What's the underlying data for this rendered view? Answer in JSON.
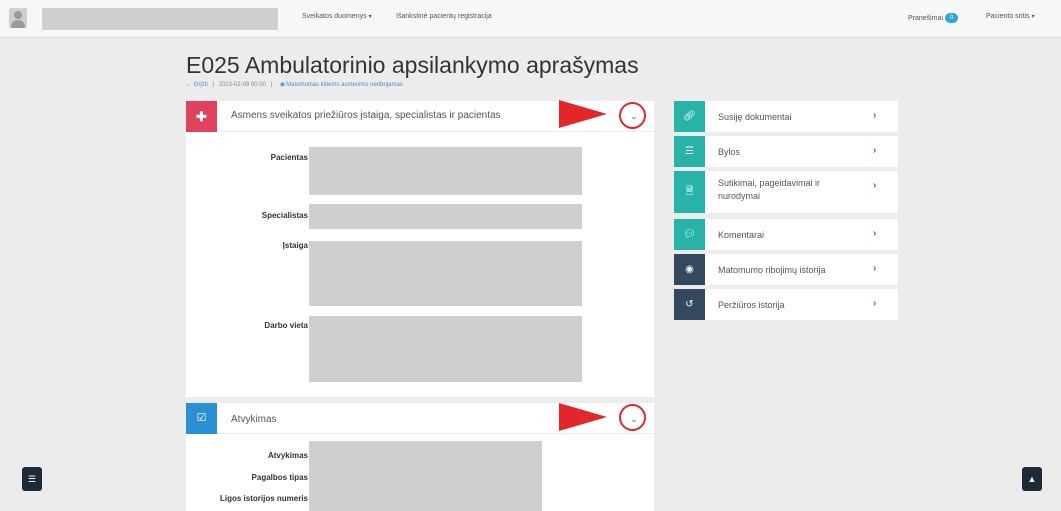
{
  "topbar": {
    "nav_health": "Sveikatos duomenys",
    "nav_registration": "Išankstinė pacientų registracija",
    "notifications_label": "Pranešimai",
    "notifications_count": "0",
    "patient_area": "Paciento sritis"
  },
  "page": {
    "title": "E025 Ambulatorinio apsilankymo aprašymas",
    "back": "← Grįžti",
    "separator": "|",
    "datetime": "2023-02-09 00:00",
    "visibility": "Matomumas kitiems asmenims neribojamas"
  },
  "section_institution": {
    "title": "Asmens sveikatos priežiūros įstaiga, specialistas ir pacientas",
    "fields": [
      "Pacientas",
      "Specialistas",
      "Įstaiga",
      "Darbo vieta"
    ]
  },
  "section_arrival": {
    "title": "Atvykimas",
    "fields": [
      "Atvykimas",
      "Pagalbos tipas",
      "Ligos istorijos numeris"
    ]
  },
  "side_menu": [
    {
      "label": "Susiję dokumentai",
      "icon": "link-icon",
      "color": "#27b3a8"
    },
    {
      "label": "Bylos",
      "icon": "list-icon",
      "color": "#27b3a8"
    },
    {
      "label": "Sutikimai, pageidavimai ir nurodymai",
      "icon": "document-icon",
      "color": "#27b3a8"
    },
    {
      "label": "Komentarai",
      "icon": "comments-icon",
      "color": "#27b3a8"
    },
    {
      "label": "Matomumo ribojimų istorija",
      "icon": "eye-icon",
      "color": "#34495e"
    },
    {
      "label": "Peržiūros istorija",
      "icon": "history-icon",
      "color": "#34495e"
    }
  ],
  "colors": {
    "accent_red": "#e0415c",
    "accent_blue": "#2b8fd4",
    "annotation_red": "#e2262a",
    "placeholder_gray": "#cfcfcf"
  }
}
